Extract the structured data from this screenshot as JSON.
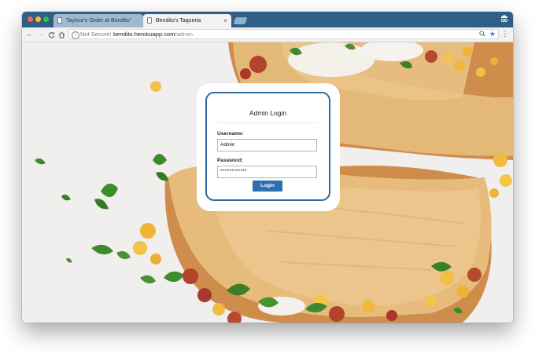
{
  "browser": {
    "tabs": [
      {
        "title": "Taylour's Order at Bendito's Ta",
        "active": false
      },
      {
        "title": "Bendito's Taqueria",
        "active": true
      }
    ],
    "close_glyph": "×",
    "security_label": "Not Secure",
    "url_host": "bendito.herokuapp.com",
    "url_path": "/admin",
    "info_glyph": "i",
    "icons": [
      "back-icon",
      "forward-icon",
      "reload-icon",
      "home-icon",
      "info-icon",
      "zoom-icon",
      "star-icon",
      "menu-icon",
      "incognito-icon"
    ]
  },
  "login": {
    "title": "Admin Login",
    "username_label": "Username:",
    "username_value": "Admin",
    "password_label": "Password:",
    "password_value": "************",
    "button_label": "Login"
  },
  "colors": {
    "tabbar": "#2f5f86",
    "card_border": "#2e6a9e",
    "button": "#2c6faf",
    "star": "#3b78e7"
  }
}
